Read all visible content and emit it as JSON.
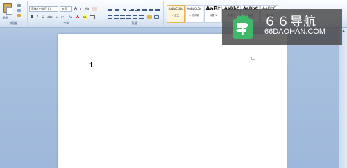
{
  "ribbon": {
    "clipboard": {
      "paste_label": "粘贴",
      "group_label": "剪贴板"
    },
    "font": {
      "font_name": "黑体 (中文正文)",
      "font_size": "五号",
      "bold": "B",
      "italic": "I",
      "underline": "U",
      "strike": "abc",
      "subscript": "x₂",
      "superscript": "x²",
      "change_case": "Aa",
      "font_color": "A",
      "highlight": "ab",
      "grow": "A",
      "shrink": "A",
      "group_label": "字体"
    },
    "paragraph": {
      "group_label": "段落"
    },
    "styles": {
      "tiles": [
        {
          "sample": "AaBbCcDc",
          "name": "» 正文"
        },
        {
          "sample": "AaBbCcDc",
          "name": "» 无间隔"
        },
        {
          "sample": "AaBt",
          "name": "标题 1"
        },
        {
          "sample": "AaBbC",
          "name": "标题 2"
        },
        {
          "sample": "AaBbC",
          "name": "标题"
        },
        {
          "sample": "AaBbC",
          "name": "副标题"
        }
      ]
    }
  },
  "watermark": {
    "title": "６６导航",
    "subtitle": "66DAOHAN.COM",
    "logo": "signpost-logo-icon"
  },
  "colors": {
    "ribbon_bg": "#dbe6f4",
    "workspace_bg": "#a9c1df",
    "page_bg": "#ffffff",
    "logo_green": "#3fb86a"
  }
}
